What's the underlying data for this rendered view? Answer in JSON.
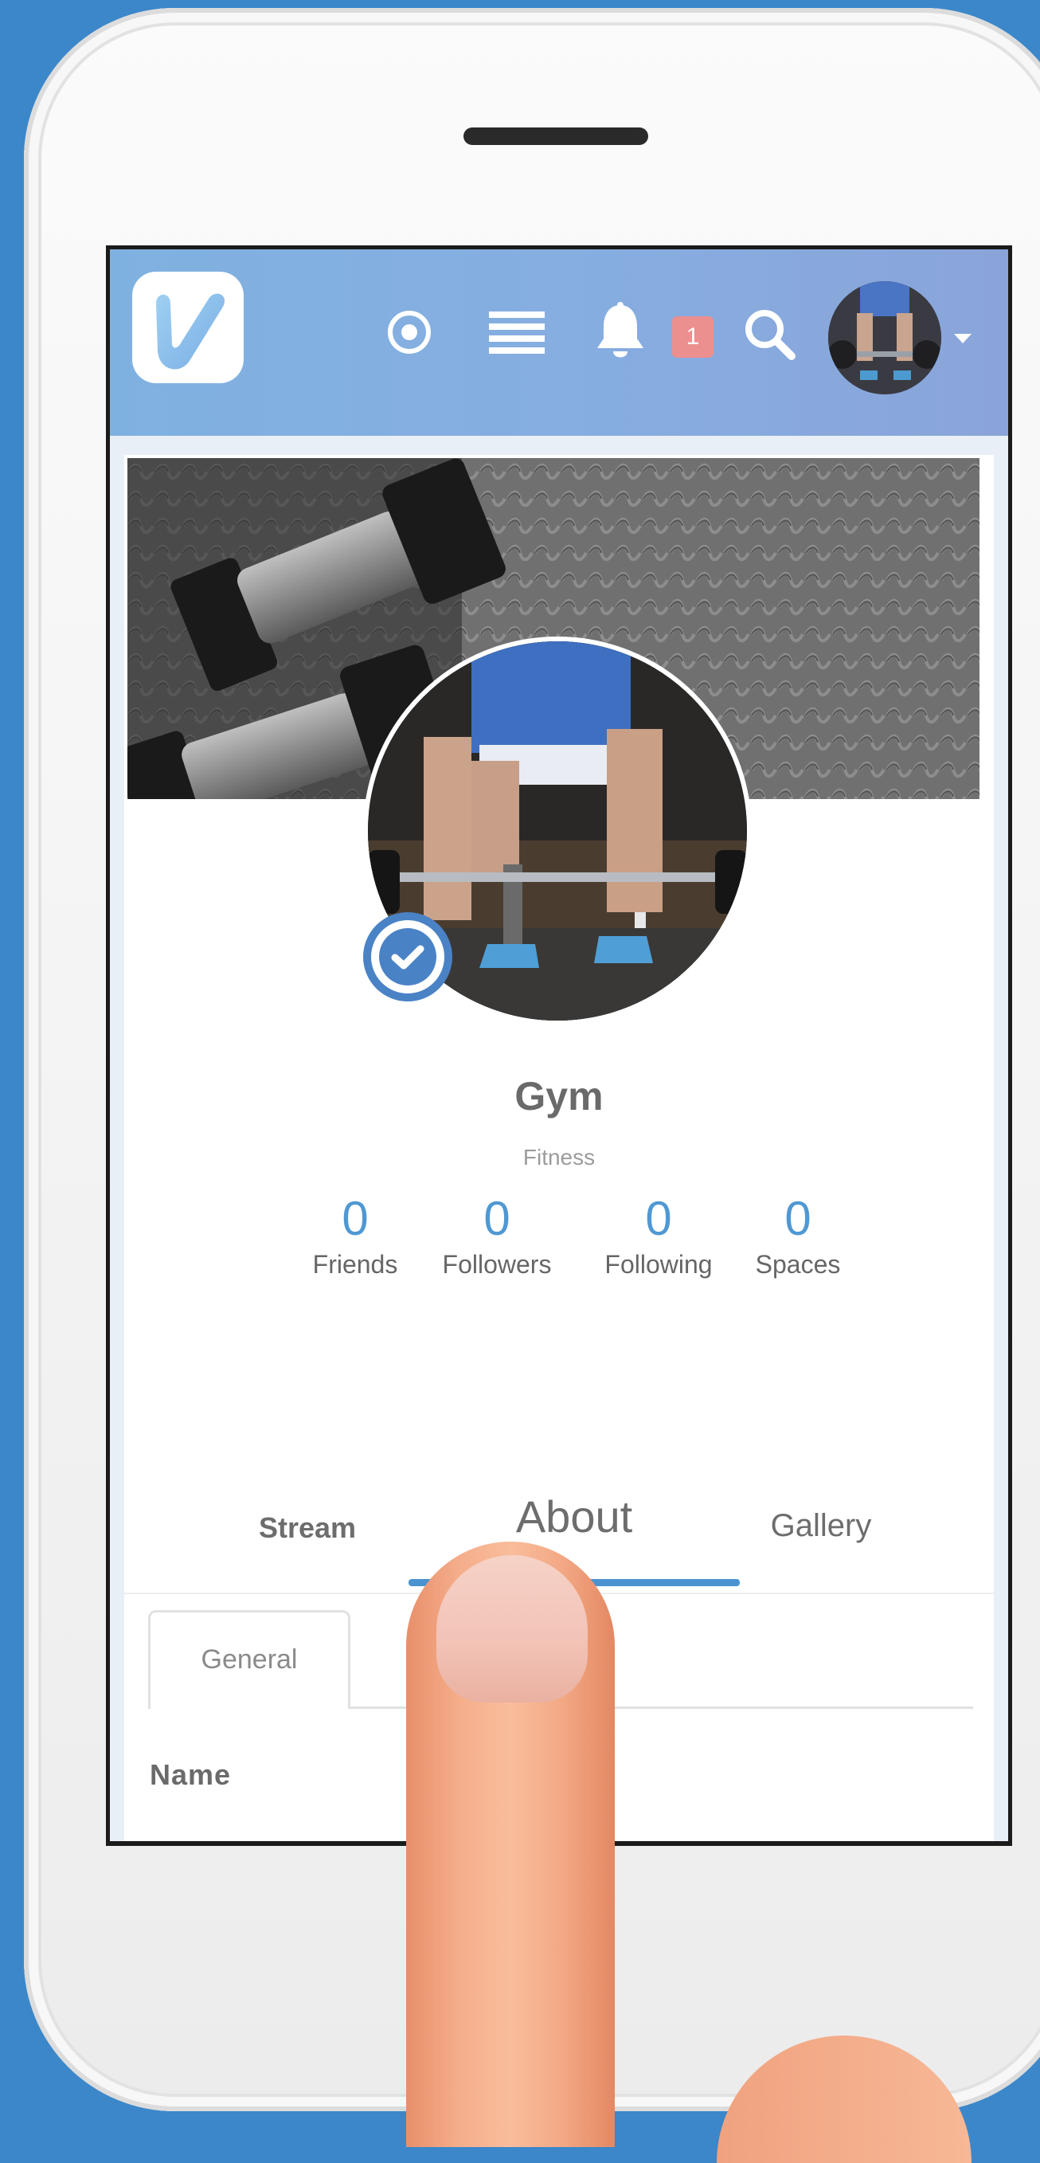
{
  "topbar": {
    "notifications_count": "1",
    "icons": [
      "logo-icon",
      "activity-icon",
      "menu-icon",
      "bell-icon",
      "search-icon",
      "avatar",
      "caret-down-icon"
    ]
  },
  "profile": {
    "name": "Gym",
    "category": "Fitness",
    "verified": true
  },
  "stats": [
    {
      "value": "0",
      "label": "Friends"
    },
    {
      "value": "0",
      "label": "Followers"
    },
    {
      "value": "0",
      "label": "Following"
    },
    {
      "value": "0",
      "label": "Spaces"
    }
  ],
  "tabs": {
    "stream": "Stream",
    "about": "About",
    "gallery": "Gallery",
    "active": "About"
  },
  "about": {
    "subtab_general": "General",
    "name_label": "Name"
  },
  "colors": {
    "background": "#3b87c9",
    "accent": "#4f98d3",
    "badge": "#ec8f8f",
    "verified": "#4a82c6"
  }
}
